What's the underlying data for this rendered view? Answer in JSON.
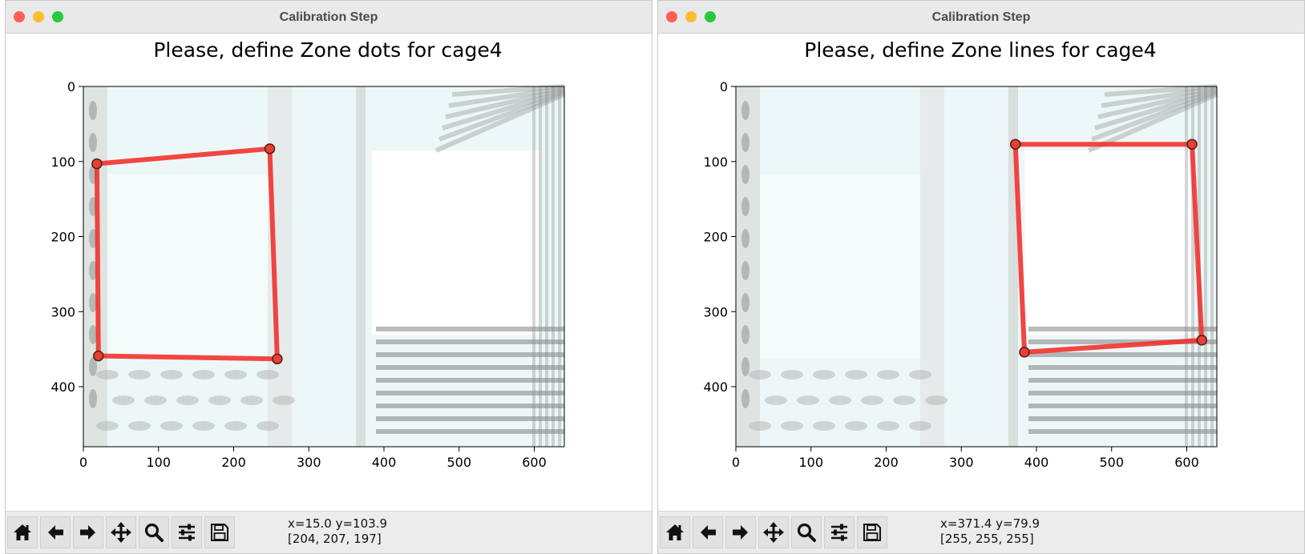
{
  "colors": {
    "polygon": "#f2322d",
    "vertex_fill": "#e34234",
    "vertex_edge": "#5a1a16",
    "image_bg": "#eef7f7"
  },
  "windows": [
    {
      "title": "Calibration Step",
      "plot_title": "Please, define Zone dots for cage4",
      "xticks": [
        "0",
        "100",
        "200",
        "300",
        "400",
        "500",
        "600"
      ],
      "yticks": [
        "0",
        "100",
        "200",
        "300",
        "400"
      ],
      "toolbar": {
        "buttons": [
          "home-icon",
          "back-arrow-icon",
          "forward-arrow-icon",
          "pan-move-icon",
          "zoom-magnifier-icon",
          "configure-subplots-icon",
          "save-floppy-icon"
        ],
        "coords": "x=15.0 y=103.9",
        "pixel": "[204, 207, 197]"
      },
      "chart_data": {
        "type": "image-with-polygon",
        "xlim": [
          0,
          640
        ],
        "ylim": [
          480,
          0
        ],
        "points": [
          [
            18,
            103
          ],
          [
            248,
            83
          ],
          [
            258,
            363
          ],
          [
            20,
            359
          ]
        ],
        "closed": true
      }
    },
    {
      "title": "Calibration Step",
      "plot_title": "Please, define Zone lines for cage4",
      "xticks": [
        "0",
        "100",
        "200",
        "300",
        "400",
        "500",
        "600"
      ],
      "yticks": [
        "0",
        "100",
        "200",
        "300",
        "400"
      ],
      "toolbar": {
        "buttons": [
          "home-icon",
          "back-arrow-icon",
          "forward-arrow-icon",
          "pan-move-icon",
          "zoom-magnifier-icon",
          "configure-subplots-icon",
          "save-floppy-icon"
        ],
        "coords": "x=371.4 y=79.9",
        "pixel": "[255, 255, 255]"
      },
      "chart_data": {
        "type": "image-with-polygon",
        "xlim": [
          0,
          640
        ],
        "ylim": [
          480,
          0
        ],
        "points": [
          [
            372,
            77
          ],
          [
            607,
            77
          ],
          [
            620,
            338
          ],
          [
            384,
            354
          ]
        ],
        "closed": true
      }
    }
  ]
}
